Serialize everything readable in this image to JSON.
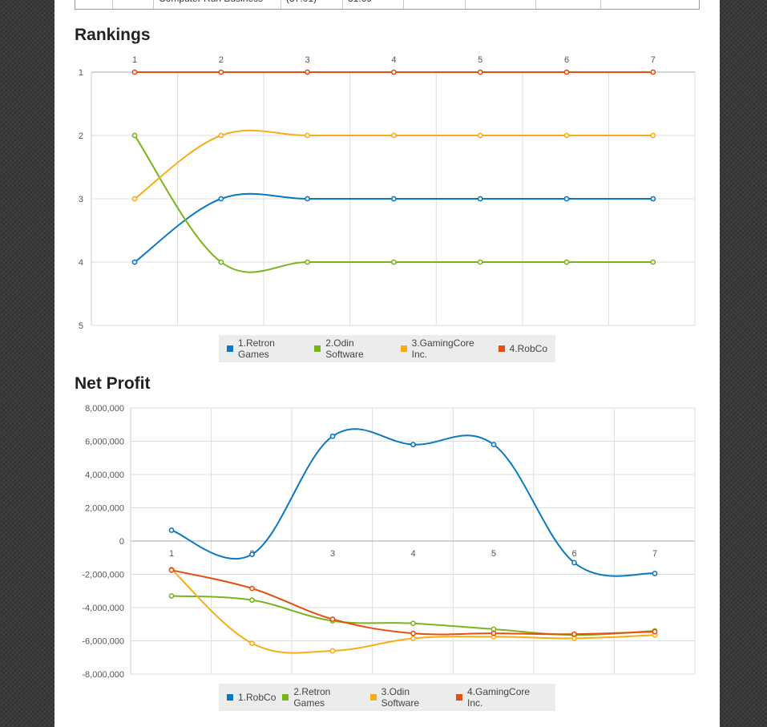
{
  "top_table": {
    "cells": [
      "",
      "",
      "Computer Run Business",
      "(37.01)",
      "31.69",
      "",
      "",
      "",
      ""
    ]
  },
  "rankings": {
    "title": "Rankings"
  },
  "net_profit": {
    "title": "Net Profit"
  },
  "chart_data": [
    {
      "type": "line",
      "title": "Rankings",
      "x": [
        1,
        2,
        3,
        4,
        5,
        6,
        7
      ],
      "y_ticks": [
        1,
        2,
        3,
        4,
        5
      ],
      "ylim": [
        1,
        5
      ],
      "y_inverted": true,
      "x_axis_position": "top",
      "grid": true,
      "legend_position": "bottom",
      "series": [
        {
          "name": "1.Retron Games",
          "color": "#0a78c2",
          "values": [
            4,
            3,
            3,
            3,
            3,
            3,
            3
          ]
        },
        {
          "name": "2.Odin Software",
          "color": "#78b51c",
          "values": [
            2,
            4,
            4,
            4,
            4,
            4,
            4
          ]
        },
        {
          "name": "3.GamingCore Inc.",
          "color": "#f8ad14",
          "values": [
            3,
            2,
            2,
            2,
            2,
            2,
            2
          ]
        },
        {
          "name": "4.RobCo",
          "color": "#e84e0f",
          "values": [
            1,
            1,
            1,
            1,
            1,
            1,
            1
          ]
        }
      ]
    },
    {
      "type": "line",
      "title": "Net Profit",
      "x": [
        1,
        2,
        3,
        4,
        5,
        6,
        7
      ],
      "y_ticks": [
        8000000,
        6000000,
        4000000,
        2000000,
        0,
        -2000000,
        -4000000,
        -6000000,
        -8000000
      ],
      "y_tick_labels": [
        "8,000,000",
        "6,000,000",
        "4,000,000",
        "2,000,000",
        "0",
        "-2,000,000",
        "-4,000,000",
        "-6,000,000",
        "-8,000,000"
      ],
      "ylim": [
        -8000000,
        8000000
      ],
      "grid": true,
      "legend_position": "bottom",
      "series": [
        {
          "name": "1.RobCo",
          "color": "#0a78c2",
          "values": [
            650000,
            -800000,
            6300000,
            5800000,
            5800000,
            -1300000,
            -1950000
          ]
        },
        {
          "name": "2.Retron Games",
          "color": "#78b51c",
          "values": [
            -3300000,
            -3550000,
            -4800000,
            -4950000,
            -5300000,
            -5650000,
            -5400000
          ]
        },
        {
          "name": "3.Odin Software",
          "color": "#f8ad14",
          "values": [
            -1700000,
            -6150000,
            -6600000,
            -5850000,
            -5750000,
            -5850000,
            -5650000
          ]
        },
        {
          "name": "4.GamingCore Inc.",
          "color": "#e84e0f",
          "values": [
            -1750000,
            -2850000,
            -4700000,
            -5550000,
            -5550000,
            -5600000,
            -5450000
          ]
        }
      ]
    }
  ]
}
